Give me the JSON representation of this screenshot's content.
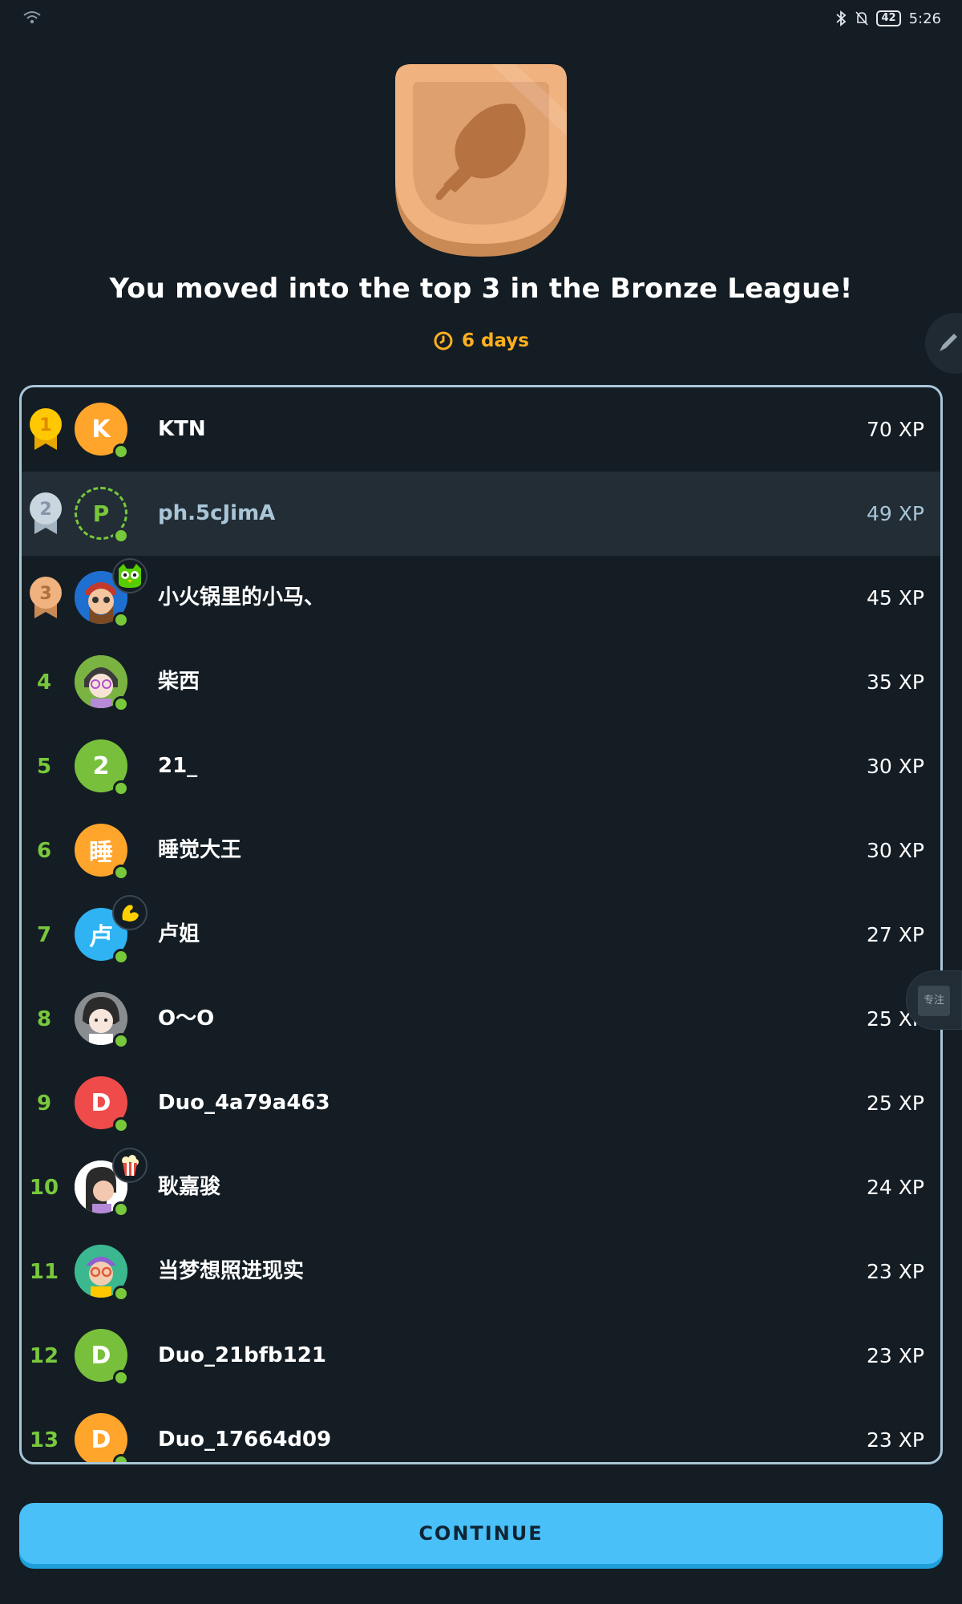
{
  "status_bar": {
    "time": "5:26",
    "battery": "42",
    "wifi_icon": "wifi-icon",
    "bluetooth_icon": "bluetooth-icon",
    "mute_icon": "bell-off-icon"
  },
  "headline": "You moved into the top 3 in the Bronze League!",
  "timer": {
    "label": "6 days",
    "icon": "clock-icon"
  },
  "colors": {
    "background": "#141d24",
    "accent_green": "#78c83c",
    "timer_orange": "#ffb020",
    "button_blue": "#49c0f8",
    "highlight_row": "#222d35"
  },
  "leaderboard": [
    {
      "rank": "1",
      "name": "KTN",
      "xp": "70 XP",
      "avatar_letter": "K",
      "avatar_color": "#ffa52c",
      "medal": "gold"
    },
    {
      "rank": "2",
      "name": "ph.5cJimA",
      "xp": "49 XP",
      "avatar_letter": "P",
      "avatar_color": "dashed",
      "medal": "silver",
      "current_user": true
    },
    {
      "rank": "3",
      "name": "小火锅里的小马、",
      "xp": "45 XP",
      "avatar_letter": "",
      "avatar_color": "#1f6fd1",
      "medal": "bronze",
      "badge": "duo-owl-icon"
    },
    {
      "rank": "4",
      "name": "柴西",
      "xp": "35 XP",
      "avatar_letter": "",
      "avatar_color": "#7ab342"
    },
    {
      "rank": "5",
      "name": "21_",
      "xp": "30 XP",
      "avatar_letter": "2",
      "avatar_color": "#78c03c"
    },
    {
      "rank": "6",
      "name": "睡觉大王",
      "xp": "30 XP",
      "avatar_letter": "睡",
      "avatar_color": "#ffa52c"
    },
    {
      "rank": "7",
      "name": "卢姐",
      "xp": "27 XP",
      "avatar_letter": "卢",
      "avatar_color": "#2fb3f3",
      "badge": "flexed-arm-icon"
    },
    {
      "rank": "8",
      "name": "O～O",
      "xp": "25 XP",
      "avatar_letter": "",
      "avatar_color": "#8a8d90"
    },
    {
      "rank": "9",
      "name": "Duo_4a79a463",
      "xp": "25 XP",
      "avatar_letter": "D",
      "avatar_color": "#ef4b4b"
    },
    {
      "rank": "10",
      "name": "耿嘉骏",
      "xp": "24 XP",
      "avatar_letter": "",
      "avatar_color": "#ffffff",
      "badge": "popcorn-icon"
    },
    {
      "rank": "11",
      "name": "当梦想照进现实",
      "xp": "23 XP",
      "avatar_letter": "",
      "avatar_color": "#3bb88f"
    },
    {
      "rank": "12",
      "name": "Duo_21bfb121",
      "xp": "23 XP",
      "avatar_letter": "D",
      "avatar_color": "#78c03c"
    },
    {
      "rank": "13",
      "name": "Duo_17664d09",
      "xp": "23 XP",
      "avatar_letter": "D",
      "avatar_color": "#ffa52c"
    }
  ],
  "edge_focus_label": "专注",
  "continue_label": "CONTINUE"
}
